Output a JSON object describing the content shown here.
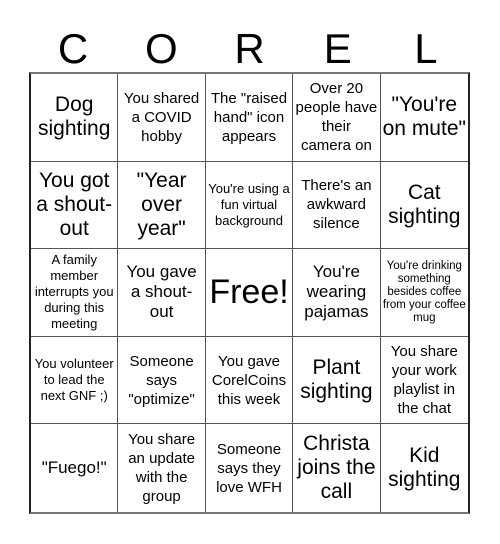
{
  "header": {
    "letters": [
      "C",
      "O",
      "R",
      "E",
      "L"
    ]
  },
  "board": {
    "cells": [
      {
        "text": "Dog sighting",
        "size": "l"
      },
      {
        "text": "You shared a COVID hobby",
        "size": "s"
      },
      {
        "text": "The \"raised hand\" icon appears",
        "size": "s"
      },
      {
        "text": "Over 20 people have their camera on",
        "size": "s"
      },
      {
        "text": "\"You're on mute\"",
        "size": "l"
      },
      {
        "text": "You got a shout-out",
        "size": "l"
      },
      {
        "text": "\"Year over year\"",
        "size": "l"
      },
      {
        "text": "You're using a fun virtual background",
        "size": "xs"
      },
      {
        "text": "There's an awkward silence",
        "size": "s"
      },
      {
        "text": "Cat sighting",
        "size": "l"
      },
      {
        "text": "A family member interrupts you during this meeting",
        "size": "xs"
      },
      {
        "text": "You gave a shout-out",
        "size": "m"
      },
      {
        "text": "Free!",
        "size": "xl"
      },
      {
        "text": "You're wearing pajamas",
        "size": "m"
      },
      {
        "text": "You're drinking something besides coffee from your coffee mug",
        "size": "xxs"
      },
      {
        "text": "You volunteer to lead the next GNF ;)",
        "size": "xs"
      },
      {
        "text": "Someone says \"optimize\"",
        "size": "s"
      },
      {
        "text": "You gave CorelCoins this week",
        "size": "s"
      },
      {
        "text": "Plant sighting",
        "size": "l"
      },
      {
        "text": "You share your work playlist in the chat",
        "size": "s"
      },
      {
        "text": "\"Fuego!\"",
        "size": "m"
      },
      {
        "text": "You share an update with the group",
        "size": "s"
      },
      {
        "text": "Someone says they love WFH",
        "size": "s"
      },
      {
        "text": "Christa joins the call",
        "size": "l"
      },
      {
        "text": "Kid sighting",
        "size": "l"
      }
    ]
  }
}
